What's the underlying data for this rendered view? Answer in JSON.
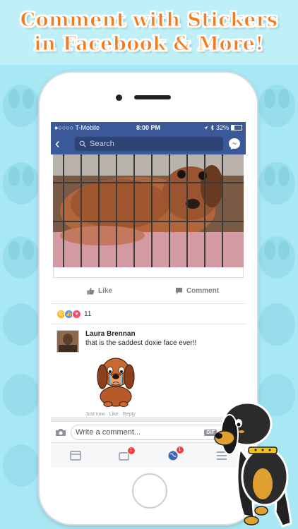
{
  "banner": {
    "line1": "Comment with Stickers",
    "line2": "in Facebook & More!"
  },
  "status": {
    "carrier": "●○○○○ T-Mobile",
    "time": "8:00 PM",
    "battery": "32%"
  },
  "nav": {
    "search_placeholder": "Search"
  },
  "post": {
    "like_label": "Like",
    "comment_label": "Comment",
    "reaction_count": "11"
  },
  "comment": {
    "author": "Laura Brennan",
    "text": "that is the saddest doxie face ever!!",
    "meta": "Just now · Like · Reply"
  },
  "composer": {
    "placeholder": "Write a comment...",
    "gif_label": "GIF"
  },
  "tabs": [
    {
      "icon": "news-feed-icon",
      "badge": ""
    },
    {
      "icon": "friend-requests-icon",
      "badge": "1"
    },
    {
      "icon": "notifications-globe-icon",
      "badge": "1"
    },
    {
      "icon": "menu-icon",
      "badge": ""
    }
  ],
  "colors": {
    "facebook_blue": "#3b5998",
    "banner_orange": "#f47a1f",
    "background": "#a8e8f4",
    "badge_red": "#fa3e3e"
  }
}
